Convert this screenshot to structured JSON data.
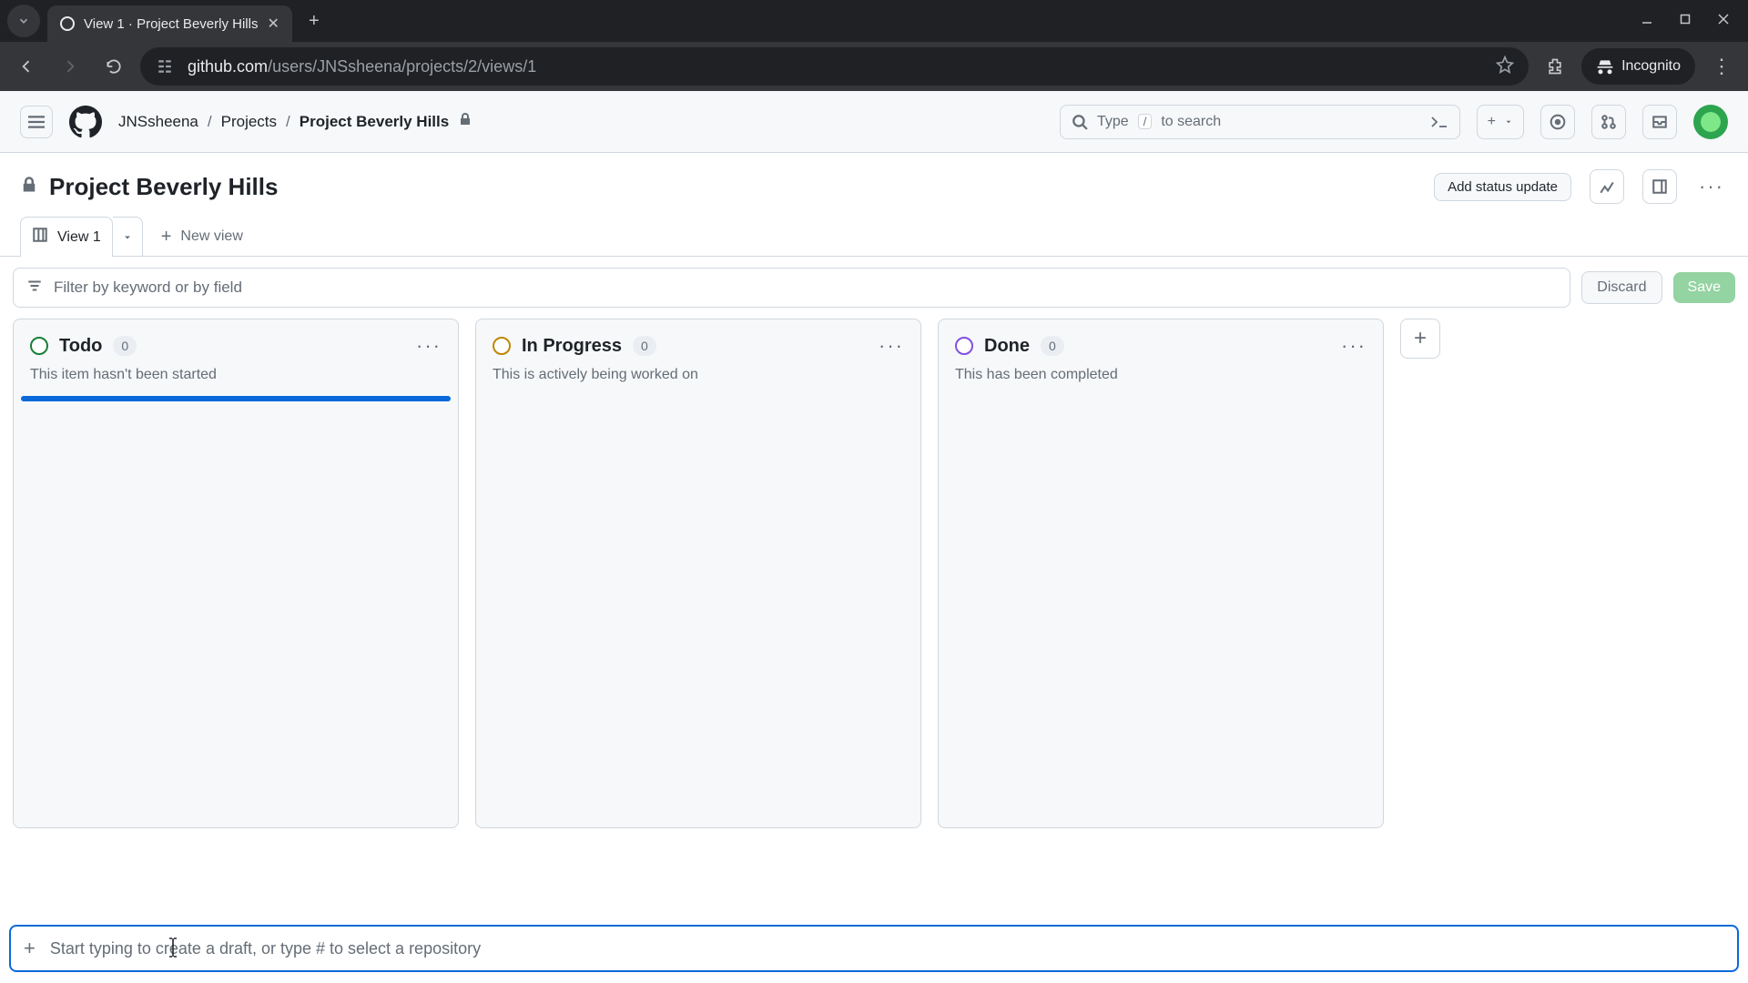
{
  "browser": {
    "tab_title": "View 1 · Project Beverly Hills",
    "url_host": "github.com",
    "url_path": "/users/JNSsheena/projects/2/views/1",
    "incognito_label": "Incognito"
  },
  "header": {
    "breadcrumb": {
      "user": "JNSsheena",
      "section": "Projects",
      "project": "Project Beverly Hills"
    },
    "search_prefix": "Type",
    "search_key": "/",
    "search_suffix": "to search"
  },
  "project": {
    "title": "Project Beverly Hills",
    "status_button": "Add status update"
  },
  "views": {
    "active_tab": "View 1",
    "new_view": "New view"
  },
  "filter": {
    "placeholder": "Filter by keyword or by field",
    "discard": "Discard",
    "save": "Save"
  },
  "columns": [
    {
      "title": "Todo",
      "count": "0",
      "desc": "This item hasn't been started",
      "status": "todo",
      "active_drop": true
    },
    {
      "title": "In Progress",
      "count": "0",
      "desc": "This is actively being worked on",
      "status": "progress",
      "active_drop": false
    },
    {
      "title": "Done",
      "count": "0",
      "desc": "This has been completed",
      "status": "done",
      "active_drop": false
    }
  ],
  "add_item": {
    "placeholder": "Start typing to create a draft, or type # to select a repository"
  }
}
